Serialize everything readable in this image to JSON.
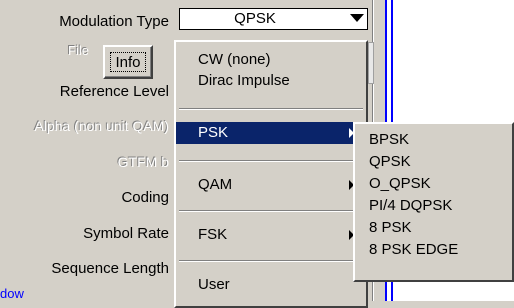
{
  "labels": {
    "modulation_type": "Modulation Type",
    "file": "File",
    "reference_level": "Reference Level",
    "alpha": "Alpha (non unit QAM)",
    "gtfm": "GTFM b",
    "coding": "Coding",
    "symbol_rate": "Symbol Rate",
    "sequence_length": "Sequence Length"
  },
  "combo": {
    "value": "QPSK"
  },
  "info_button": {
    "label": "Info"
  },
  "menu": {
    "items": [
      {
        "label": "CW (none)"
      },
      {
        "label": "Dirac Impulse"
      },
      {
        "label": "PSK"
      },
      {
        "label": "QAM"
      },
      {
        "label": "FSK"
      },
      {
        "label": "User"
      }
    ]
  },
  "submenu": {
    "items": [
      "BPSK",
      "QPSK",
      "O_QPSK",
      "PI/4 DQPSK",
      "8 PSK",
      "8 PSK EDGE"
    ]
  },
  "bottom_link": "dow",
  "colors": {
    "highlight": "#0a246a",
    "face": "#d4d0c8",
    "accent_line": "#0000ff"
  }
}
